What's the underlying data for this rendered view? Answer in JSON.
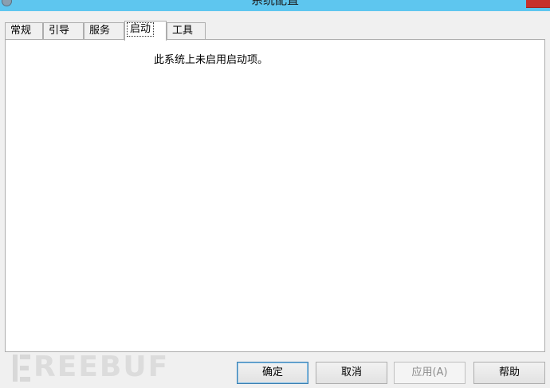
{
  "window": {
    "title": "系统配置"
  },
  "tabs": [
    {
      "label": "常规",
      "active": false
    },
    {
      "label": "引导",
      "active": false
    },
    {
      "label": "服务",
      "active": false
    },
    {
      "label": "启动",
      "active": true
    },
    {
      "label": "工具",
      "active": false
    }
  ],
  "panel": {
    "message": "此系统上未启用启动项。"
  },
  "buttons": {
    "ok": "确定",
    "cancel": "取消",
    "apply": "应用(A)",
    "help": "帮助"
  },
  "watermark": {
    "text": "REEBUF"
  },
  "colors": {
    "titlebar": "#5ec6ef",
    "close_button": "#c7302b",
    "default_button_border": "#3c7fb1"
  }
}
